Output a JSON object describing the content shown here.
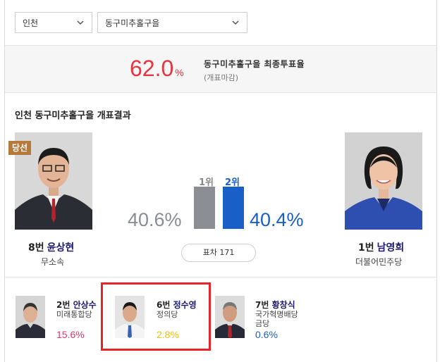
{
  "filters": {
    "region": "인천",
    "district": "동구미추홀구을"
  },
  "turnout": {
    "value": "62.0",
    "unit": "%",
    "label": "동구미추홀구을 최종투표율",
    "status": "(개표마감)"
  },
  "section_title": "인천 동구미추홀구을 개표결과",
  "winner_badge": "당선",
  "leading": {
    "number": "8번",
    "name": "윤상현",
    "party": "무소속",
    "percent": "40.6%",
    "rank": "1위",
    "share": 40.6
  },
  "runner_up": {
    "number": "1번",
    "name": "남영희",
    "party": "더불어민주당",
    "percent": "40.4%",
    "rank": "2위",
    "share": 40.4
  },
  "margin": "표차 171",
  "others": [
    {
      "number": "2번",
      "name": "안상수",
      "party": "미래통합당",
      "percent": "15.6%",
      "pct_color": "#e0346b"
    },
    {
      "number": "6번",
      "name": "정수영",
      "party": "정의당",
      "percent": "2.8%",
      "pct_color": "#f2c200"
    },
    {
      "number": "7번",
      "name": "황창식",
      "party": "국가혁명배당금당",
      "percent": "0.6%",
      "pct_color": "#1a5fc7"
    }
  ],
  "colors": {
    "turnout": "#e8343f",
    "leading_bar": "#8a8d92",
    "runner_bar": "#1a5fc7",
    "badge": "#b57a3b",
    "highlight": "#e8232a"
  }
}
